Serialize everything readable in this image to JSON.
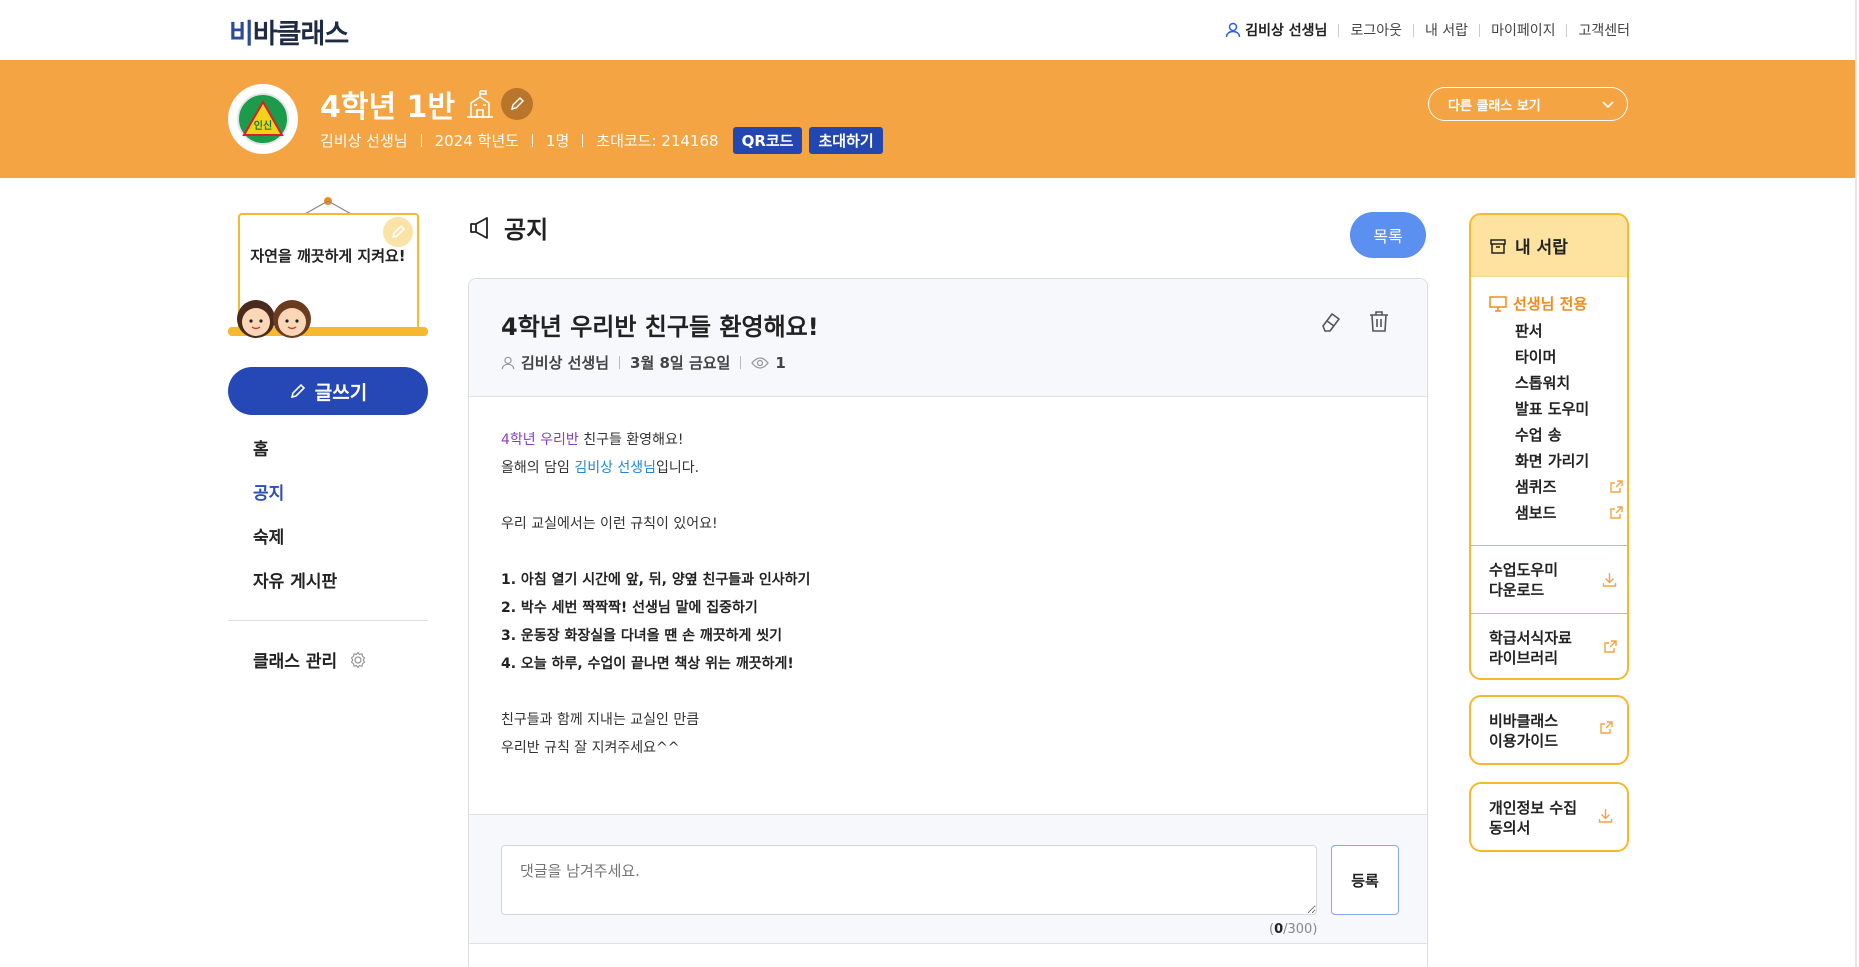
{
  "brand": {
    "logo_prefix": "비",
    "logo_rest": "바클래스"
  },
  "topnav": {
    "user": "김비상 선생님",
    "links": [
      "로그아웃",
      "내 서랍",
      "마이페이지",
      "고객센터"
    ]
  },
  "classInfo": {
    "emblem_text": "인신",
    "title": "4학년 1반",
    "teacher": "김비상 선생님",
    "year": "2024 학년도",
    "members": "1명",
    "invite_code": "초대코드: 214168",
    "qr_label": "QR코드",
    "invite_label": "초대하기",
    "other_class_label": "다른 클래스 보기"
  },
  "sidebar": {
    "note": "자연을 깨끗하게 지켜요!",
    "write_label": "글쓰기",
    "nav": [
      "홈",
      "공지",
      "숙제",
      "자유 게시판"
    ],
    "active": "공지",
    "manage_label": "클래스 관리"
  },
  "main": {
    "section_title": "공지",
    "list_label": "목록"
  },
  "post": {
    "title": "4학년 우리반 친구들 환영해요!",
    "author": "김비상 선생님",
    "date": "3월 8일 금요일",
    "views": "1",
    "body": {
      "l1_highlight": "4학년 우리반",
      "l1_rest": " 친구들 환영해요!",
      "l2_pre": "올해의 담임 ",
      "l2_highlight": "김비상 선생님",
      "l2_post": "입니다.",
      "l3": "우리 교실에서는 이런 규칙이 있어요!",
      "rules": [
        "1. 아침 열기 시간에 앞, 뒤, 양옆 친구들과 인사하기",
        "2. 박수 세번 짝짝짝! 선생님 말에 집중하기",
        "3. 운동장 화장실을 다녀올 땐 손 깨끗하게 씻기",
        "4. 오늘 하루, 수업이 끝나면 책상 위는 깨끗하게!"
      ],
      "closing1": "친구들과 함께 지내는 교실인 만큼",
      "closing2": "우리반 규칙 잘 지켜주세요^^"
    }
  },
  "comment": {
    "placeholder": "댓글을 남겨주세요.",
    "count": "0",
    "max": "/300)",
    "open": "(",
    "submit_label": "등록"
  },
  "drawer": {
    "title": "내 서랍",
    "teacher_only": "선생님 전용",
    "tools": [
      "판서",
      "타이머",
      "스톱워치",
      "발표 도우미",
      "수업 송",
      "화면 가리기",
      "샘퀴즈",
      "샘보드"
    ],
    "download_l1": "수업도우미",
    "download_l2": "다운로드",
    "library_l1": "학급서식자료",
    "library_l2": "라이브러리"
  },
  "guide": {
    "l1": "비바클래스",
    "l2": "이용가이드"
  },
  "privacy": {
    "l1": "개인정보 수집",
    "l2": "동의서"
  },
  "colors": {
    "header": "#f5a444",
    "primary": "#2648b6",
    "accent": "#f5b82e",
    "list_button": "#5b8ff0"
  }
}
